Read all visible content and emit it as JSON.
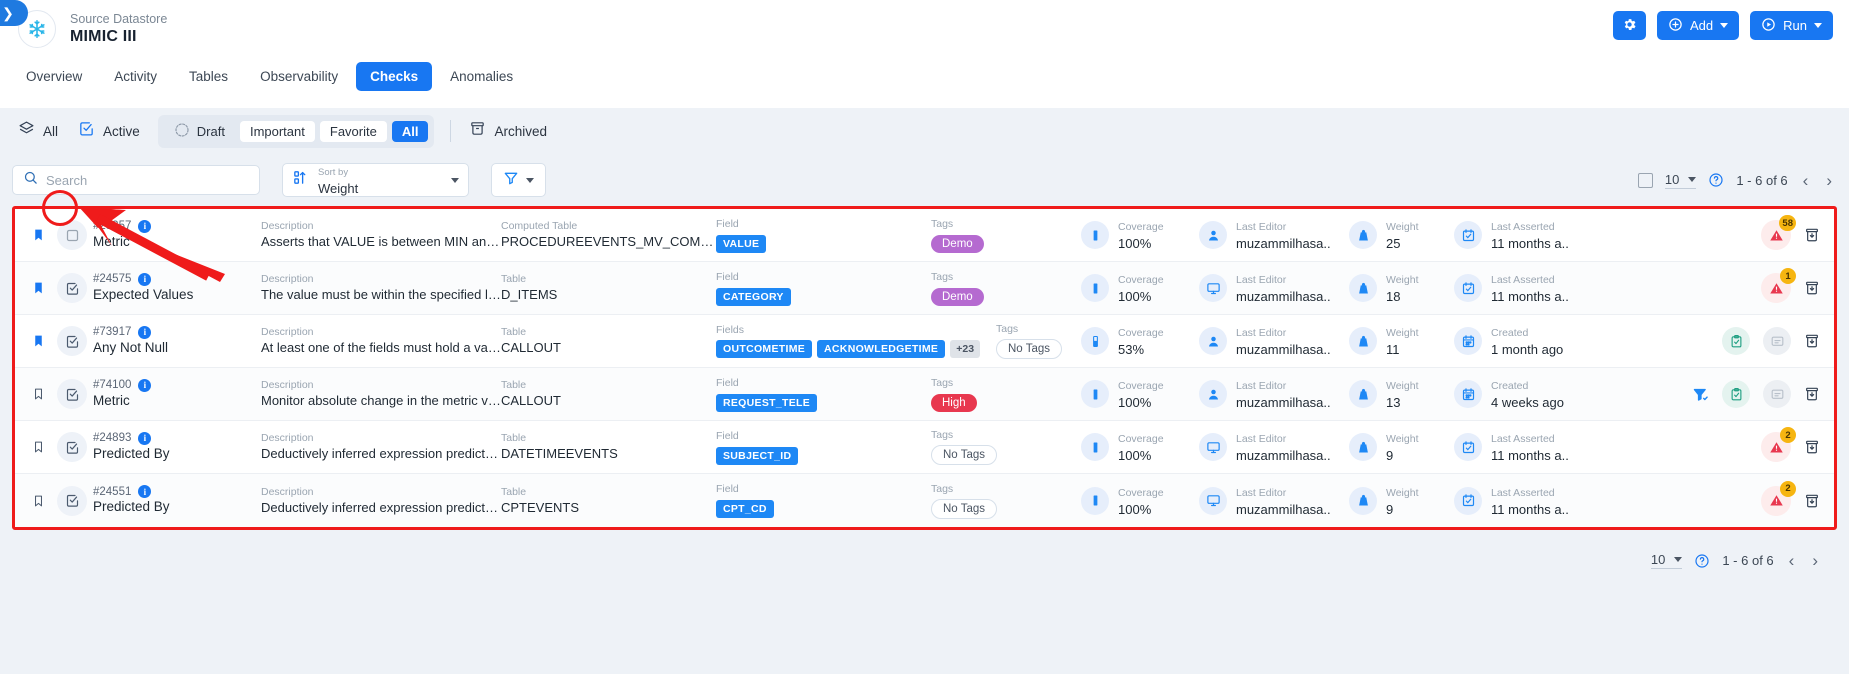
{
  "header": {
    "kicker": "Source Datastore",
    "title": "MIMIC III",
    "sidebar_toggle_icon": "chevron-right-icon",
    "logo_icon": "snowflake-icon",
    "actions": [
      {
        "id": "settings",
        "label": "",
        "icon": "gear-icon"
      },
      {
        "id": "add",
        "label": "Add",
        "icon": "plus-circle-icon"
      },
      {
        "id": "run",
        "label": "Run",
        "icon": "play-circle-icon"
      }
    ],
    "accent_color": "#1877f2"
  },
  "tabs": [
    {
      "label": "Overview",
      "active": false
    },
    {
      "label": "Activity",
      "active": false
    },
    {
      "label": "Tables",
      "active": false
    },
    {
      "label": "Observability",
      "active": false
    },
    {
      "label": "Checks",
      "active": true
    },
    {
      "label": "Anomalies",
      "active": false
    }
  ],
  "filters": {
    "all": {
      "label": "All",
      "icon": "layers-icon"
    },
    "active": {
      "label": "Active",
      "icon": "check-square-icon"
    },
    "segments": [
      {
        "label": "Draft",
        "style": "plain",
        "icon": "draft-circle-icon"
      },
      {
        "label": "Important",
        "style": "white"
      },
      {
        "label": "Favorite",
        "style": "white"
      },
      {
        "label": "All",
        "style": "blue"
      }
    ],
    "archived": {
      "label": "Archived",
      "icon": "archive-icon"
    }
  },
  "search": {
    "placeholder": "Search",
    "value": "",
    "icon": "search-icon"
  },
  "sort": {
    "kicker": "Sort by",
    "value": "Weight",
    "icon": "sort-asc-icon"
  },
  "filter_button": {
    "icon": "funnel-icon"
  },
  "pagination": {
    "page_size": "10",
    "range": "1 - 6 of 6",
    "prev_icon": "chevron-left-icon",
    "next_icon": "chevron-right-icon",
    "help_icon": "help-circle-icon",
    "select_all_checkbox": false
  },
  "columns": {
    "description": "Description",
    "table": "Table",
    "computed_table": "Computed Table",
    "field": "Field",
    "fields": "Fields",
    "tags": "Tags",
    "coverage": "Coverage",
    "last_editor": "Last Editor",
    "weight": "Weight",
    "last_asserted": "Last Asserted",
    "created": "Created"
  },
  "rows": [
    {
      "bookmarked": true,
      "state_icon": "empty-square-icon",
      "id": "#25357",
      "name": "Metric",
      "desc_key": "Description",
      "desc_val": "Asserts that VALUE is between MIN and MAX",
      "table_key": "Computed Table",
      "table_val": "PROCEDUREEVENTS_MV_COMPUTED",
      "field_key": "Field",
      "fields": [
        "VALUE"
      ],
      "fields_more": "",
      "tags_key": "Tags",
      "tag_label": "Demo",
      "tag_style": "demo",
      "coverage_key": "Coverage",
      "coverage_val": "100%",
      "coverage_icon": "coverage-full-icon",
      "editor_key": "Last Editor",
      "editor_val": "muzammilhasa..",
      "editor_icon": "person-icon",
      "weight_key": "Weight",
      "weight_val": "25",
      "weight_icon": "weight-icon",
      "date_key": "Last Asserted",
      "date_val": "11 months a..",
      "date_icon": "calendar-check-icon",
      "alert_count": "58",
      "has_alert": true,
      "has_filter_icon": false,
      "has_clipboard": false,
      "has_note": false,
      "archive_icon": "archive-down-icon"
    },
    {
      "bookmarked": true,
      "state_icon": "check-square-icon",
      "id": "#24575",
      "name": "Expected Values",
      "desc_key": "Description",
      "desc_val": "The value must be within the specified list of v..",
      "table_key": "Table",
      "table_val": "D_ITEMS",
      "field_key": "Field",
      "fields": [
        "CATEGORY"
      ],
      "fields_more": "",
      "tags_key": "Tags",
      "tag_label": "Demo",
      "tag_style": "demo",
      "coverage_key": "Coverage",
      "coverage_val": "100%",
      "coverage_icon": "coverage-full-icon",
      "editor_key": "Last Editor",
      "editor_val": "muzammilhasa..",
      "editor_icon": "monitor-icon",
      "weight_key": "Weight",
      "weight_val": "18",
      "weight_icon": "weight-icon",
      "date_key": "Last Asserted",
      "date_val": "11 months a..",
      "date_icon": "calendar-check-icon",
      "alert_count": "1",
      "has_alert": true,
      "has_filter_icon": false,
      "has_clipboard": false,
      "has_note": false,
      "archive_icon": "archive-down-icon"
    },
    {
      "bookmarked": true,
      "state_icon": "check-square-icon",
      "id": "#73917",
      "name": "Any Not Null",
      "desc_key": "Description",
      "desc_val": "At least one of the fields must hold a value",
      "table_key": "Table",
      "table_val": "CALLOUT",
      "field_key": "Fields",
      "fields": [
        "OUTCOMETIME",
        "ACKNOWLEDGETIME"
      ],
      "fields_more": "+23",
      "tags_key": "Tags",
      "tag_label": "No Tags",
      "tag_style": "none",
      "coverage_key": "Coverage",
      "coverage_val": "53%",
      "coverage_icon": "coverage-half-icon",
      "editor_key": "Last Editor",
      "editor_val": "muzammilhasa..",
      "editor_icon": "person-icon",
      "weight_key": "Weight",
      "weight_val": "11",
      "weight_icon": "weight-icon",
      "date_key": "Created",
      "date_val": "1 month ago",
      "date_icon": "calendar-icon",
      "alert_count": "",
      "has_alert": false,
      "has_filter_icon": false,
      "has_clipboard": true,
      "has_note": true,
      "archive_icon": "archive-down-icon"
    },
    {
      "bookmarked": false,
      "state_icon": "check-square-icon",
      "id": "#74100",
      "name": "Metric",
      "desc_key": "Description",
      "desc_val": "Monitor absolute change in the metric value w..",
      "table_key": "Table",
      "table_val": "CALLOUT",
      "field_key": "Field",
      "fields": [
        "REQUEST_TELE"
      ],
      "fields_more": "",
      "tags_key": "Tags",
      "tag_label": "High",
      "tag_style": "high",
      "coverage_key": "Coverage",
      "coverage_val": "100%",
      "coverage_icon": "coverage-full-icon",
      "editor_key": "Last Editor",
      "editor_val": "muzammilhasa..",
      "editor_icon": "person-icon",
      "weight_key": "Weight",
      "weight_val": "13",
      "weight_icon": "weight-icon",
      "date_key": "Created",
      "date_val": "4 weeks ago",
      "date_icon": "calendar-icon",
      "alert_count": "",
      "has_alert": false,
      "has_filter_icon": true,
      "has_clipboard": true,
      "has_note": true,
      "archive_icon": "archive-down-icon"
    },
    {
      "bookmarked": false,
      "state_icon": "check-square-icon",
      "id": "#24893",
      "name": "Predicted By",
      "desc_key": "Description",
      "desc_val": "Deductively inferred expression predicts a val..",
      "table_key": "Table",
      "table_val": "DATETIMEEVENTS",
      "field_key": "Field",
      "fields": [
        "SUBJECT_ID"
      ],
      "fields_more": "",
      "tags_key": "Tags",
      "tag_label": "No Tags",
      "tag_style": "none",
      "coverage_key": "Coverage",
      "coverage_val": "100%",
      "coverage_icon": "coverage-full-icon",
      "editor_key": "Last Editor",
      "editor_val": "muzammilhasa..",
      "editor_icon": "monitor-icon",
      "weight_key": "Weight",
      "weight_val": "9",
      "weight_icon": "weight-icon",
      "date_key": "Last Asserted",
      "date_val": "11 months a..",
      "date_icon": "calendar-check-icon",
      "alert_count": "2",
      "has_alert": true,
      "has_filter_icon": false,
      "has_clipboard": false,
      "has_note": false,
      "archive_icon": "archive-down-icon"
    },
    {
      "bookmarked": false,
      "state_icon": "check-square-icon",
      "id": "#24551",
      "name": "Predicted By",
      "desc_key": "Description",
      "desc_val": "Deductively inferred expression predicts a val..",
      "table_key": "Table",
      "table_val": "CPTEVENTS",
      "field_key": "Field",
      "fields": [
        "CPT_CD"
      ],
      "fields_more": "",
      "tags_key": "Tags",
      "tag_label": "No Tags",
      "tag_style": "none",
      "coverage_key": "Coverage",
      "coverage_val": "100%",
      "coverage_icon": "coverage-full-icon",
      "editor_key": "Last Editor",
      "editor_val": "muzammilhasa..",
      "editor_icon": "monitor-icon",
      "weight_key": "Weight",
      "weight_val": "9",
      "weight_icon": "weight-icon",
      "date_key": "Last Asserted",
      "date_val": "11 months a..",
      "date_icon": "calendar-check-icon",
      "alert_count": "2",
      "has_alert": true,
      "has_filter_icon": false,
      "has_clipboard": false,
      "has_note": false,
      "archive_icon": "archive-down-icon"
    }
  ],
  "bottom_pagination": {
    "page_size": "10",
    "range": "1 - 6 of 6"
  },
  "annotations": {
    "highlight_color": "#ef1b1b",
    "target": "row-1-state-checkbox"
  }
}
